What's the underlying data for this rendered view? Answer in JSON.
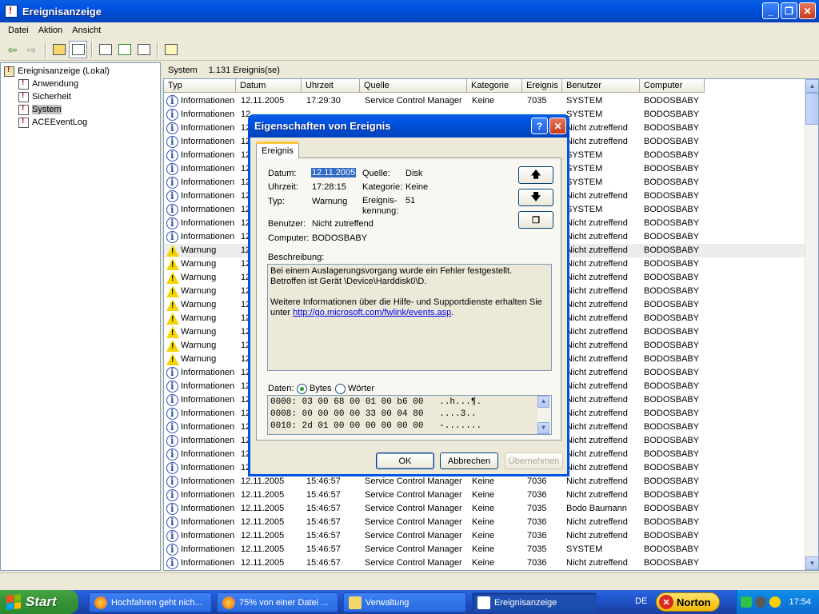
{
  "window": {
    "title": "Ereignisanzeige"
  },
  "menu": [
    "Datei",
    "Aktion",
    "Ansicht"
  ],
  "tree": {
    "root": "Ereignisanzeige (Lokal)",
    "items": [
      "Anwendung",
      "Sicherheit",
      "System",
      "ACEEventLog"
    ]
  },
  "pane": {
    "name": "System",
    "count": "1.131 Ereignis(se)"
  },
  "columns": [
    "Typ",
    "Datum",
    "Uhrzeit",
    "Quelle",
    "Kategorie",
    "Ereignis",
    "Benutzer",
    "Computer"
  ],
  "rows": [
    {
      "type": "info",
      "typ": "Informationen",
      "datum": "12.11.2005",
      "zeit": "17:29:30",
      "quelle": "Service Control Manager",
      "kat": "Keine",
      "ev": "7035",
      "user": "SYSTEM",
      "comp": "BODOSBABY"
    },
    {
      "type": "info",
      "typ": "Informationen",
      "datum": "12",
      "zeit": "",
      "quelle": "",
      "kat": "",
      "ev": "",
      "user": "SYSTEM",
      "comp": "BODOSBABY"
    },
    {
      "type": "info",
      "typ": "Informationen",
      "datum": "12",
      "zeit": "",
      "quelle": "",
      "kat": "",
      "ev": "",
      "user": "Nicht zutreffend",
      "comp": "BODOSBABY"
    },
    {
      "type": "info",
      "typ": "Informationen",
      "datum": "12",
      "zeit": "",
      "quelle": "",
      "kat": "",
      "ev": "",
      "user": "Nicht zutreffend",
      "comp": "BODOSBABY"
    },
    {
      "type": "info",
      "typ": "Informationen",
      "datum": "12",
      "zeit": "",
      "quelle": "",
      "kat": "",
      "ev": "",
      "user": "SYSTEM",
      "comp": "BODOSBABY"
    },
    {
      "type": "info",
      "typ": "Informationen",
      "datum": "12",
      "zeit": "",
      "quelle": "",
      "kat": "",
      "ev": "",
      "user": "SYSTEM",
      "comp": "BODOSBABY"
    },
    {
      "type": "info",
      "typ": "Informationen",
      "datum": "12",
      "zeit": "",
      "quelle": "",
      "kat": "",
      "ev": "",
      "user": "SYSTEM",
      "comp": "BODOSBABY"
    },
    {
      "type": "info",
      "typ": "Informationen",
      "datum": "12",
      "zeit": "",
      "quelle": "",
      "kat": "",
      "ev": "",
      "user": "Nicht zutreffend",
      "comp": "BODOSBABY"
    },
    {
      "type": "info",
      "typ": "Informationen",
      "datum": "12",
      "zeit": "",
      "quelle": "",
      "kat": "",
      "ev": "",
      "user": "SYSTEM",
      "comp": "BODOSBABY"
    },
    {
      "type": "info",
      "typ": "Informationen",
      "datum": "12",
      "zeit": "",
      "quelle": "",
      "kat": "",
      "ev": "",
      "user": "Nicht zutreffend",
      "comp": "BODOSBABY"
    },
    {
      "type": "info",
      "typ": "Informationen",
      "datum": "12",
      "zeit": "",
      "quelle": "",
      "kat": "",
      "ev": "",
      "user": "Nicht zutreffend",
      "comp": "BODOSBABY"
    },
    {
      "type": "warn",
      "typ": "Warnung",
      "datum": "12",
      "zeit": "",
      "quelle": "",
      "kat": "",
      "ev": "",
      "user": "Nicht zutreffend",
      "comp": "BODOSBABY",
      "highlight": true
    },
    {
      "type": "warn",
      "typ": "Warnung",
      "datum": "12",
      "zeit": "",
      "quelle": "",
      "kat": "",
      "ev": "",
      "user": "Nicht zutreffend",
      "comp": "BODOSBABY"
    },
    {
      "type": "warn",
      "typ": "Warnung",
      "datum": "12",
      "zeit": "",
      "quelle": "",
      "kat": "",
      "ev": "",
      "user": "Nicht zutreffend",
      "comp": "BODOSBABY"
    },
    {
      "type": "warn",
      "typ": "Warnung",
      "datum": "12",
      "zeit": "",
      "quelle": "",
      "kat": "",
      "ev": "",
      "user": "Nicht zutreffend",
      "comp": "BODOSBABY"
    },
    {
      "type": "warn",
      "typ": "Warnung",
      "datum": "12",
      "zeit": "",
      "quelle": "",
      "kat": "",
      "ev": "",
      "user": "Nicht zutreffend",
      "comp": "BODOSBABY"
    },
    {
      "type": "warn",
      "typ": "Warnung",
      "datum": "12",
      "zeit": "",
      "quelle": "",
      "kat": "",
      "ev": "",
      "user": "Nicht zutreffend",
      "comp": "BODOSBABY"
    },
    {
      "type": "warn",
      "typ": "Warnung",
      "datum": "12",
      "zeit": "",
      "quelle": "",
      "kat": "",
      "ev": "",
      "user": "Nicht zutreffend",
      "comp": "BODOSBABY"
    },
    {
      "type": "warn",
      "typ": "Warnung",
      "datum": "12",
      "zeit": "",
      "quelle": "",
      "kat": "",
      "ev": "",
      "user": "Nicht zutreffend",
      "comp": "BODOSBABY"
    },
    {
      "type": "warn",
      "typ": "Warnung",
      "datum": "12",
      "zeit": "",
      "quelle": "",
      "kat": "",
      "ev": "",
      "user": "Nicht zutreffend",
      "comp": "BODOSBABY"
    },
    {
      "type": "info",
      "typ": "Informationen",
      "datum": "12",
      "zeit": "",
      "quelle": "",
      "kat": "",
      "ev": "",
      "user": "Nicht zutreffend",
      "comp": "BODOSBABY"
    },
    {
      "type": "info",
      "typ": "Informationen",
      "datum": "12",
      "zeit": "",
      "quelle": "",
      "kat": "",
      "ev": "",
      "user": "Nicht zutreffend",
      "comp": "BODOSBABY"
    },
    {
      "type": "info",
      "typ": "Informationen",
      "datum": "12",
      "zeit": "",
      "quelle": "",
      "kat": "",
      "ev": "",
      "user": "Nicht zutreffend",
      "comp": "BODOSBABY"
    },
    {
      "type": "info",
      "typ": "Informationen",
      "datum": "12",
      "zeit": "",
      "quelle": "",
      "kat": "",
      "ev": "",
      "user": "Nicht zutreffend",
      "comp": "BODOSBABY"
    },
    {
      "type": "info",
      "typ": "Informationen",
      "datum": "12",
      "zeit": "",
      "quelle": "",
      "kat": "",
      "ev": "",
      "user": "Nicht zutreffend",
      "comp": "BODOSBABY"
    },
    {
      "type": "info",
      "typ": "Informationen",
      "datum": "12",
      "zeit": "",
      "quelle": "",
      "kat": "",
      "ev": "",
      "user": "Nicht zutreffend",
      "comp": "BODOSBABY"
    },
    {
      "type": "info",
      "typ": "Informationen",
      "datum": "12",
      "zeit": "",
      "quelle": "",
      "kat": "",
      "ev": "",
      "user": "Nicht zutreffend",
      "comp": "BODOSBABY"
    },
    {
      "type": "info",
      "typ": "Informationen",
      "datum": "12",
      "zeit": "",
      "quelle": "",
      "kat": "",
      "ev": "",
      "user": "Nicht zutreffend",
      "comp": "BODOSBABY"
    },
    {
      "type": "info",
      "typ": "Informationen",
      "datum": "12.11.2005",
      "zeit": "15:46:57",
      "quelle": "Service Control Manager",
      "kat": "Keine",
      "ev": "7036",
      "user": "Nicht zutreffend",
      "comp": "BODOSBABY"
    },
    {
      "type": "info",
      "typ": "Informationen",
      "datum": "12.11.2005",
      "zeit": "15:46:57",
      "quelle": "Service Control Manager",
      "kat": "Keine",
      "ev": "7036",
      "user": "Nicht zutreffend",
      "comp": "BODOSBABY"
    },
    {
      "type": "info",
      "typ": "Informationen",
      "datum": "12.11.2005",
      "zeit": "15:46:57",
      "quelle": "Service Control Manager",
      "kat": "Keine",
      "ev": "7035",
      "user": "Bodo Baumann",
      "comp": "BODOSBABY"
    },
    {
      "type": "info",
      "typ": "Informationen",
      "datum": "12.11.2005",
      "zeit": "15:46:57",
      "quelle": "Service Control Manager",
      "kat": "Keine",
      "ev": "7036",
      "user": "Nicht zutreffend",
      "comp": "BODOSBABY"
    },
    {
      "type": "info",
      "typ": "Informationen",
      "datum": "12.11.2005",
      "zeit": "15:46:57",
      "quelle": "Service Control Manager",
      "kat": "Keine",
      "ev": "7036",
      "user": "Nicht zutreffend",
      "comp": "BODOSBABY"
    },
    {
      "type": "info",
      "typ": "Informationen",
      "datum": "12.11.2005",
      "zeit": "15:46:57",
      "quelle": "Service Control Manager",
      "kat": "Keine",
      "ev": "7035",
      "user": "SYSTEM",
      "comp": "BODOSBABY"
    },
    {
      "type": "info",
      "typ": "Informationen",
      "datum": "12.11.2005",
      "zeit": "15:46:57",
      "quelle": "Service Control Manager",
      "kat": "Keine",
      "ev": "7036",
      "user": "Nicht zutreffend",
      "comp": "BODOSBABY"
    }
  ],
  "dialog": {
    "title": "Eigenschaften von Ereignis",
    "tab": "Ereignis",
    "labels": {
      "datum": "Datum:",
      "uhrzeit": "Uhrzeit:",
      "typ": "Typ:",
      "quelle": "Quelle:",
      "kategorie": "Kategorie:",
      "ereignis_1": "Ereignis-",
      "ereignis_2": "kennung:",
      "benutzer": "Benutzer:",
      "computer": "Computer:",
      "beschreibung": "Beschreibung:",
      "daten": "Daten:"
    },
    "values": {
      "datum": "12.11.2005",
      "uhrzeit": "17:28:15",
      "typ": "Warnung",
      "quelle": "Disk",
      "kategorie": "Keine",
      "ereignis": "51",
      "benutzer": "Nicht zutreffend",
      "computer": "BODOSBABY"
    },
    "description": {
      "line1": "Bei einem Auslagerungsvorgang wurde ein Fehler festgestellt. Betroffen ist Gerät \\Device\\Harddisk0\\D.",
      "line2": "Weitere Informationen über die Hilfe- und Supportdienste erhalten Sie unter ",
      "link": "http://go.microsoft.com/fwlink/events.asp",
      "end": "."
    },
    "radio_bytes": "Bytes",
    "radio_words": "Wörter",
    "data_lines": [
      "0000: 03 00 68 00 01 00 b6 00   ..h...¶.",
      "0008: 00 00 00 00 33 00 04 80   ....3..",
      "0010: 2d 01 00 00 00 00 00 00   -......."
    ],
    "buttons": {
      "ok": "OK",
      "cancel": "Abbrechen",
      "apply": "Übernehmen"
    }
  },
  "taskbar": {
    "start": "Start",
    "tasks": [
      "Hochfahren geht nich...",
      "75% von einer Datei ...",
      "Verwaltung",
      "Ereignisanzeige"
    ],
    "lang": "DE",
    "norton": "Norton",
    "clock": "17:54"
  }
}
